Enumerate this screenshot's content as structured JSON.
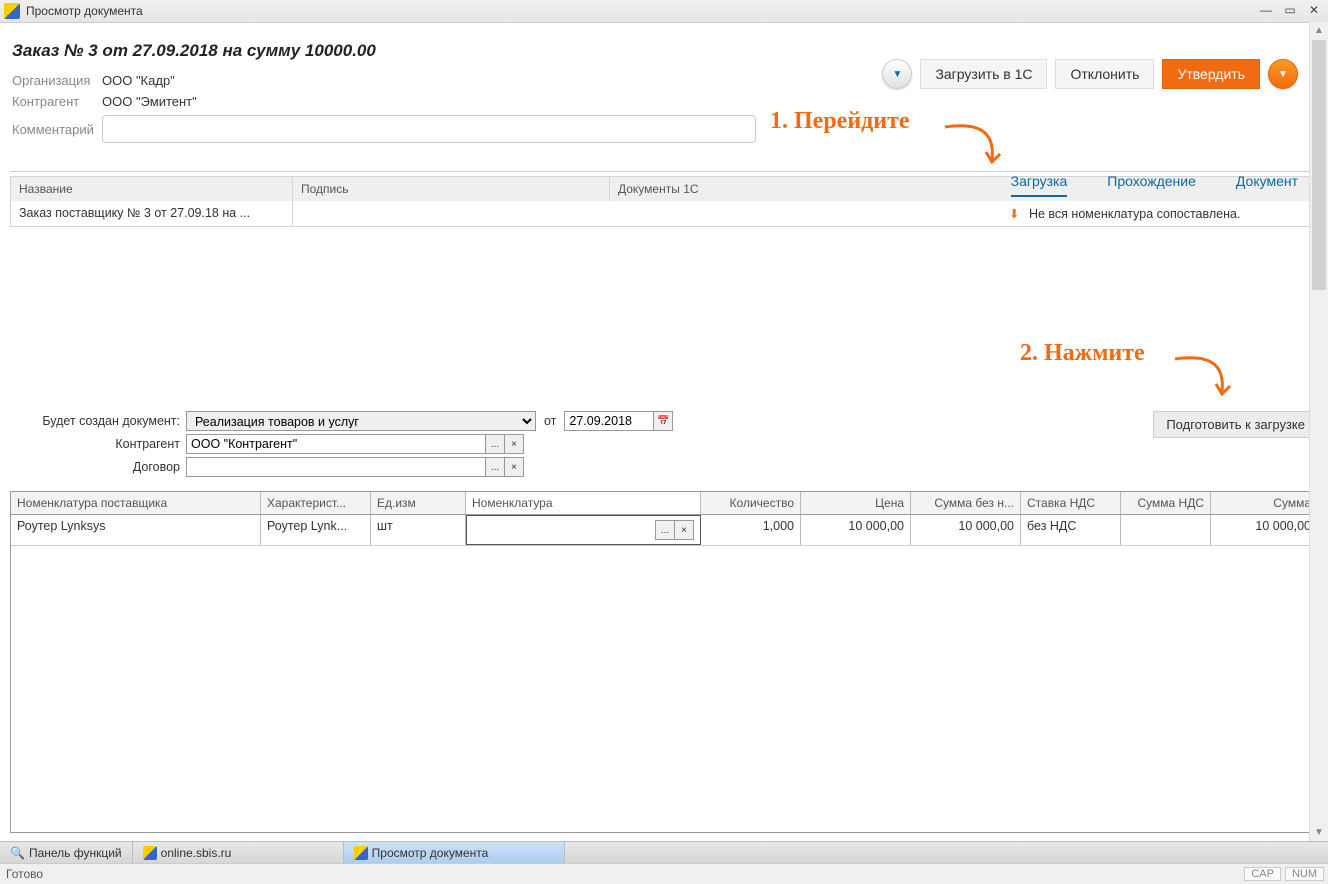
{
  "window": {
    "title": "Просмотр документа"
  },
  "doc": {
    "title": "Заказ № 3 от 27.09.2018 на сумму 10000.00"
  },
  "actions": {
    "load_in_1c": "Загрузить в 1С",
    "reject": "Отклонить",
    "approve": "Утвердить"
  },
  "meta": {
    "org_label": "Организация",
    "org_value": "ООО \"Кадр\"",
    "contr_label": "Контрагент",
    "contr_value": "ООО \"Эмитент\"",
    "comment_label": "Комментарий",
    "comment_value": ""
  },
  "tabs": {
    "load": "Загрузка",
    "flow": "Прохождение",
    "doc": "Документ"
  },
  "grid1": {
    "h_name": "Название",
    "h_sign": "Подпись",
    "h_1c": "Документы 1С",
    "row_name": "Заказ поставщику № 3 от 27.09.18 на ...",
    "warn_text": "Не вся номенклатура сопоставлена."
  },
  "form": {
    "create_label": "Будет создан документ:",
    "create_value": "Реализация товаров и услуг",
    "from_label": "от",
    "date_value": "27.09.2018",
    "contr_label": "Контрагент",
    "contr_value": "ООО \"Контрагент\"",
    "dog_label": "Договор",
    "dog_value": "",
    "prepare_btn": "Подготовить к загрузке"
  },
  "grid2": {
    "h_supp": "Номенклатура поставщика",
    "h_char": "Характерист...",
    "h_unit": "Ед.изм",
    "h_nom": "Номенклатура",
    "h_qty": "Количество",
    "h_price": "Цена",
    "h_sumwo": "Сумма без н...",
    "h_vat": "Ставка НДС",
    "h_vats": "Сумма НДС",
    "h_sum": "Сумма",
    "r_supp": "Роутер Lynksys",
    "r_char": "Роутер Lynk...",
    "r_unit": "шт",
    "r_nom": "",
    "r_qty": "1,000",
    "r_price": "10 000,00",
    "r_sumwo": "10 000,00",
    "r_vat": "без НДС",
    "r_vats": "",
    "r_sum": "10 000,00"
  },
  "taskbar": {
    "panel": "Панель функций",
    "sbis": "online.sbis.ru",
    "viewer": "Просмотр документа"
  },
  "status": {
    "text": "Готово",
    "cap": "CAP",
    "num": "NUM"
  },
  "anno": {
    "step1": "1. Перейдите",
    "step2": "2. Нажмите"
  }
}
